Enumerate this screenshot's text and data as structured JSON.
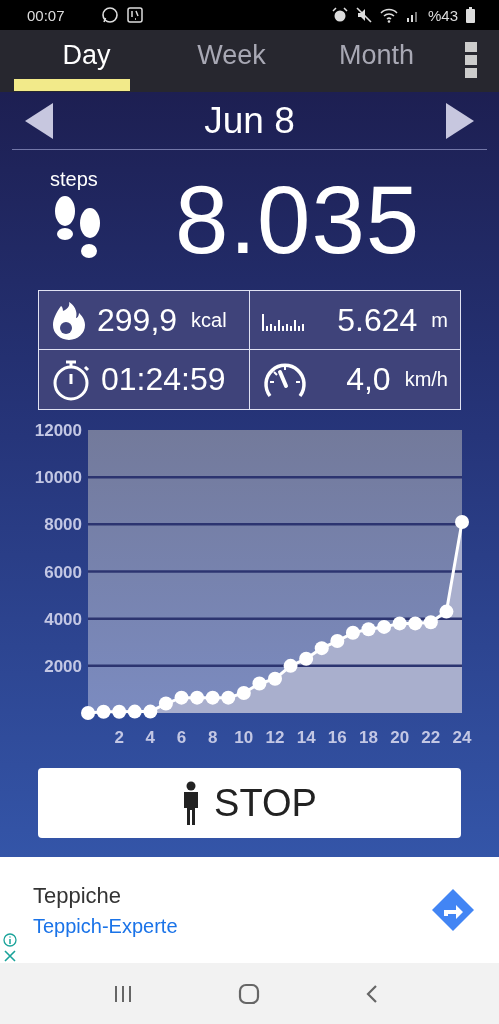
{
  "status_bar": {
    "time": "00:07",
    "battery": "%43"
  },
  "tabs": [
    {
      "label": "Day",
      "selected": true
    },
    {
      "label": "Week",
      "selected": false
    },
    {
      "label": "Month",
      "selected": false
    }
  ],
  "date": "Jun 8",
  "steps": {
    "label": "steps",
    "value": "8.035"
  },
  "stats": [
    {
      "kind": "calories",
      "value": "299,9",
      "unit": "kcal"
    },
    {
      "kind": "distance",
      "value": "5.624",
      "unit": "m"
    },
    {
      "kind": "duration",
      "value": "01:24:59"
    },
    {
      "kind": "speed",
      "value": "4,0",
      "unit": "km/h"
    }
  ],
  "chart": {
    "chart_data": {
      "type": "area",
      "x": [
        0,
        1,
        2,
        3,
        4,
        5,
        6,
        7,
        8,
        9,
        10,
        11,
        12,
        13,
        14,
        15,
        16,
        17,
        18,
        19,
        20,
        21,
        22,
        23,
        24
      ],
      "series": [
        {
          "color": "#ffffff",
          "values": [
            0,
            50,
            50,
            60,
            60,
            400,
            650,
            650,
            650,
            650,
            850,
            1250,
            1450,
            2000,
            2300,
            2750,
            3050,
            3400,
            3550,
            3650,
            3800,
            3800,
            3850,
            4300,
            8100
          ]
        }
      ],
      "grid": true,
      "xlim": [
        0,
        24
      ],
      "ylim": [
        0,
        12000
      ],
      "xticks": [
        2,
        4,
        6,
        8,
        10,
        12,
        14,
        16,
        18,
        20,
        22,
        24
      ],
      "yticks": [
        2000,
        4000,
        6000,
        8000,
        10000,
        12000
      ]
    }
  },
  "stop_button": "STOP",
  "ad": {
    "title": "Teppiche",
    "subtitle": "Teppich-Experte"
  }
}
